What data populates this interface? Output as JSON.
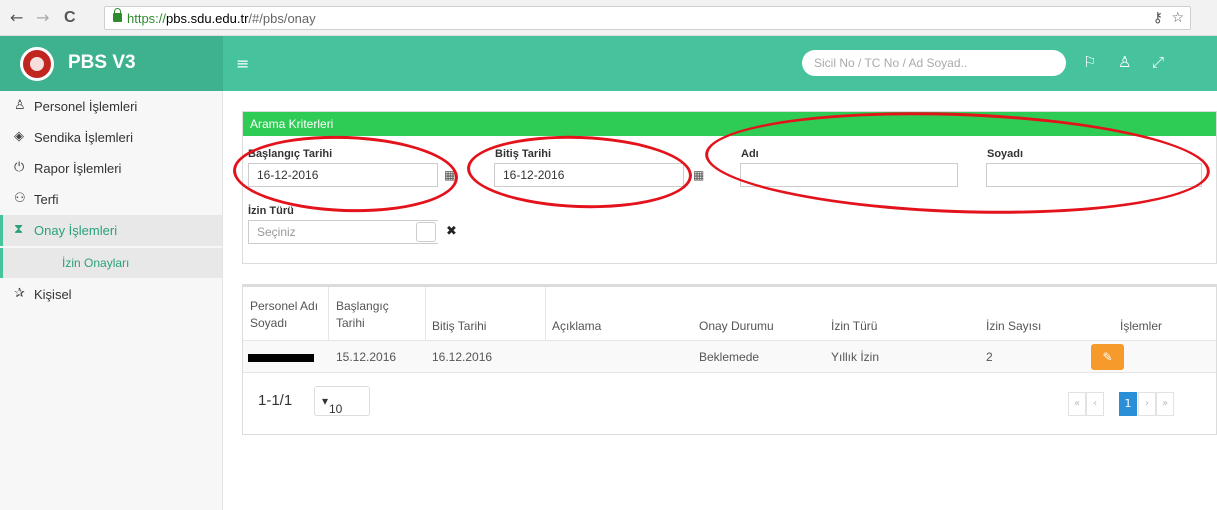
{
  "browser": {
    "url_secure": "https://",
    "url_host": "pbs.sdu.edu.tr",
    "url_path": "/#/pbs/onay",
    "back_icon": "←",
    "forward_icon": "→",
    "reload_icon": "C",
    "key_icon": "⚷",
    "star_icon": "☆"
  },
  "header": {
    "brand": "PBS V3",
    "menu_icon": "≡",
    "search_placeholder": "Sicil No / TC No / Ad Soyad..",
    "flag_icon": "⚐",
    "user_icon": "♙",
    "expand_icon": "⤢"
  },
  "sidebar": {
    "items": [
      {
        "label": "Personel İşlemleri",
        "icon": "♙"
      },
      {
        "label": "Sendika İşlemleri",
        "icon": "◈"
      },
      {
        "label": "Rapor İşlemleri",
        "icon": "⏻"
      },
      {
        "label": "Terfi",
        "icon": "⚇"
      },
      {
        "label": "Onay İşlemleri",
        "icon": "⧗"
      },
      {
        "label": "Kişisel",
        "icon": "✰"
      }
    ],
    "subitem": "İzin Onayları"
  },
  "search_panel": {
    "title": "Arama Kriterleri",
    "start_label": "Başlangıç Tarihi",
    "start_value": "16-12-2016",
    "end_label": "Bitiş Tarihi",
    "end_value": "16-12-2016",
    "name_label": "Adı",
    "surname_label": "Soyadı",
    "leave_label": "İzin Türü",
    "leave_placeholder": "Seçiniz",
    "calendar_icon": "▦",
    "clear_icon": "✖"
  },
  "table": {
    "headers": {
      "name_l1": "Personel Adı",
      "name_l2": "Soyadı",
      "start_l1": "Başlangıç",
      "start_l2": "Tarihi",
      "end": "Bitiş Tarihi",
      "desc": "Açıklama",
      "status": "Onay Durumu",
      "type": "İzin Türü",
      "count": "İzin Sayısı",
      "actions": "İşlemler"
    },
    "rows": [
      {
        "start": "15.12.2016",
        "end": "16.12.2016",
        "desc": "",
        "status": "Beklemede",
        "type": "Yıllık İzin",
        "count": "2"
      }
    ],
    "edit_icon": "✎",
    "pagination_info": "1-1/1",
    "page_size": "10",
    "current_page": "1",
    "first_icon": "«",
    "prev_icon": "‹",
    "next_icon": "›",
    "last_icon": "»"
  },
  "colors": {
    "header": "#46c29d",
    "panel_head": "#2ecc55",
    "edit_button": "#f79a2c",
    "active_page": "#2a8fd6",
    "annotation": "#e3121b"
  }
}
